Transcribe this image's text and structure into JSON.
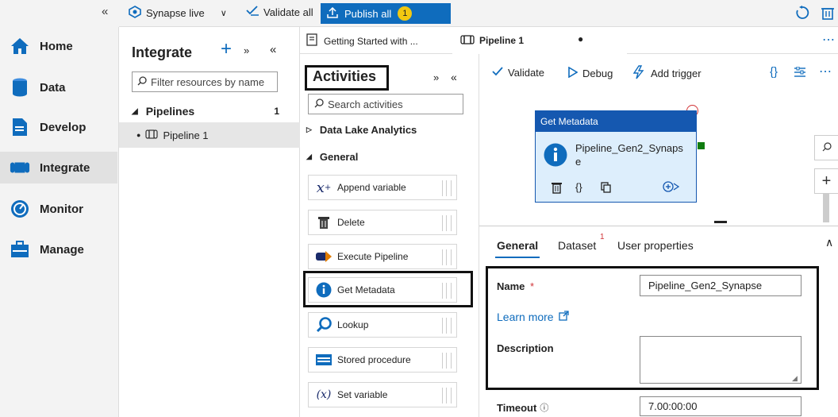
{
  "topbar": {
    "collapse_label": "«",
    "synapse_live": "Synapse live",
    "validate_all": "Validate all",
    "publish_all": "Publish all",
    "publish_badge": "1"
  },
  "nav": {
    "items": [
      {
        "label": "Home",
        "icon": "home-icon"
      },
      {
        "label": "Data",
        "icon": "database-icon"
      },
      {
        "label": "Develop",
        "icon": "document-icon"
      },
      {
        "label": "Integrate",
        "icon": "pipeline-icon"
      },
      {
        "label": "Monitor",
        "icon": "gauge-icon"
      },
      {
        "label": "Manage",
        "icon": "toolbox-icon"
      }
    ],
    "active": "Integrate"
  },
  "integrate": {
    "title": "Integrate",
    "filter_placeholder": "Filter resources by name",
    "pipelines_label": "Pipelines",
    "pipelines_count": "1",
    "pipeline_item": "Pipeline 1"
  },
  "tabs": [
    {
      "label": "Getting Started with ..."
    },
    {
      "label": "Pipeline 1"
    }
  ],
  "activities": {
    "title": "Activities",
    "search_placeholder": "Search activities",
    "group_collapsed": "Data Lake Analytics",
    "group_open": "General",
    "items": [
      {
        "label": "Append variable",
        "icon": "append-variable-icon"
      },
      {
        "label": "Delete",
        "icon": "trash-icon"
      },
      {
        "label": "Execute Pipeline",
        "icon": "execute-pipeline-icon"
      },
      {
        "label": "Get Metadata",
        "icon": "info-icon"
      },
      {
        "label": "Lookup",
        "icon": "magnifier-icon"
      },
      {
        "label": "Stored procedure",
        "icon": "stored-procedure-icon"
      },
      {
        "label": "Set variable",
        "icon": "set-variable-icon"
      }
    ]
  },
  "canvas_toolbar": {
    "validate": "Validate",
    "debug": "Debug",
    "add_trigger": "Add trigger"
  },
  "node": {
    "header": "Get Metadata",
    "name_line1": "Pipeline_Gen2_Synaps",
    "name_line2": "e"
  },
  "props": {
    "tabs": [
      "General",
      "Dataset",
      "User properties"
    ],
    "dataset_badge": "1",
    "name_label": "Name",
    "required_mark": "*",
    "name_value": "Pipeline_Gen2_Synapse",
    "learn_more": "Learn more",
    "description_label": "Description",
    "description_value": "",
    "timeout_label": "Timeout",
    "timeout_value": "7.00:00:00"
  },
  "colors": {
    "accent": "#0f6cbd",
    "node_header": "#1558b0",
    "node_body": "#ddeefc",
    "badge": "#f2c811"
  }
}
